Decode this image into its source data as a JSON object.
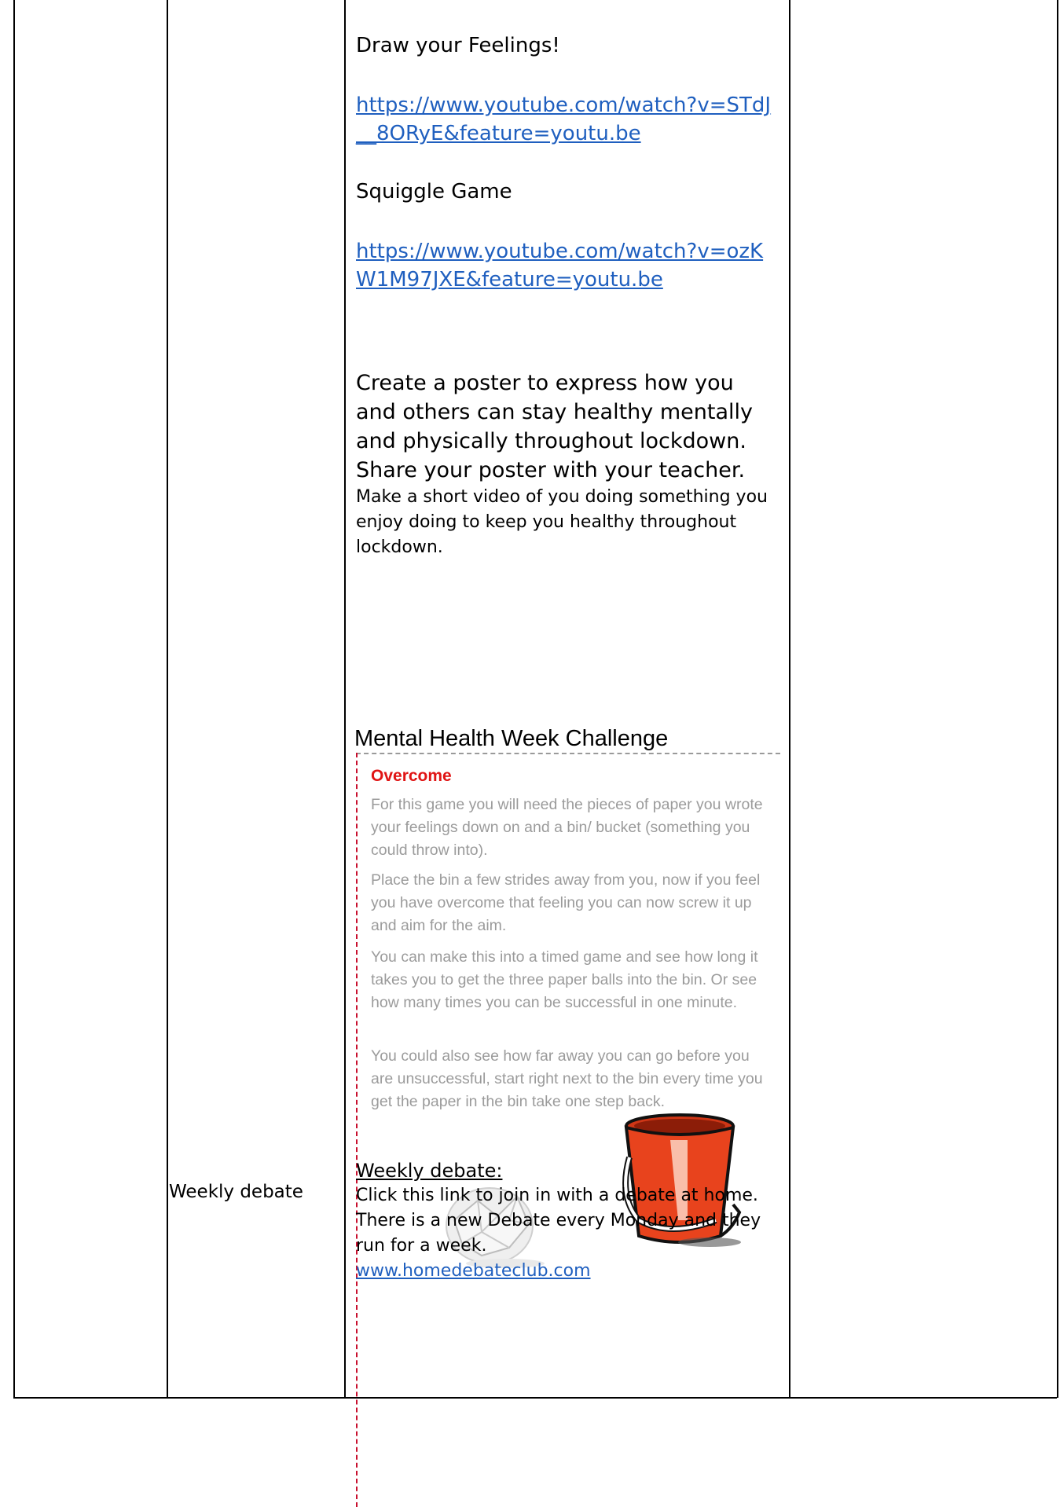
{
  "main": {
    "draw_title": "Draw your Feelings!",
    "draw_link": "https://www.youtube.com/watch?v=STdJ__8ORyE&feature=youtu.be",
    "squiggle_title": "Squiggle Game",
    "squiggle_link": "https://www.youtube.com/watch?v=ozKW1M97JXE&feature=youtu.be",
    "poster_text": "Create a poster to express how you and others can stay healthy mentally and physically throughout lockdown. Share your poster with your teacher.",
    "video_text": "Make a short video of you doing something you enjoy doing to keep you healthy throughout lockdown."
  },
  "challenge": {
    "title": "Mental Health Week Challenge",
    "heading": "Overcome",
    "paragraphs": [
      "For this game you will need the pieces of paper you wrote your feelings down on and a bin/ bucket (something you could throw into).",
      "Place the bin a few strides away from you, now if you feel you have overcome that feeling you can now screw it up and aim for the aim.",
      "You can make this into a timed game and see how long it takes you to get the three paper balls into the bin. Or see how many times you can be successful in one minute.",
      "You could also see how far away you can go before you are unsuccessful, start right next to the bin every time you get the paper in the bin take one step back."
    ],
    "icons": [
      "paper-ball-icon",
      "bucket-icon"
    ],
    "accent_color": "#e01414"
  },
  "weekly": {
    "label": "Weekly debate",
    "heading": "Weekly debate:",
    "text": "Click this link to join in with a debate at home. There is a new Debate every Monday and they run for a week.",
    "link": "www.homedebateclub.com"
  }
}
